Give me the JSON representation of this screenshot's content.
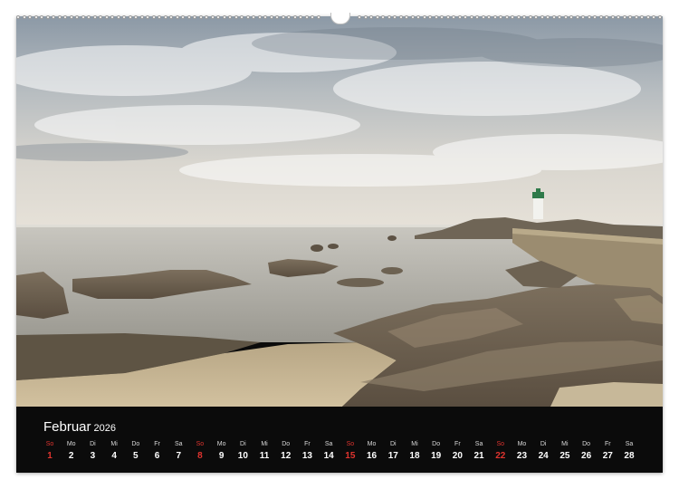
{
  "calendar": {
    "month": "Februar",
    "year": "2026",
    "sunday_color": "#e0342f",
    "days": [
      {
        "name": "So",
        "num": "1",
        "sunday": true
      },
      {
        "name": "Mo",
        "num": "2"
      },
      {
        "name": "Di",
        "num": "3"
      },
      {
        "name": "Mi",
        "num": "4"
      },
      {
        "name": "Do",
        "num": "5"
      },
      {
        "name": "Fr",
        "num": "6"
      },
      {
        "name": "Sa",
        "num": "7"
      },
      {
        "name": "So",
        "num": "8",
        "sunday": true
      },
      {
        "name": "Mo",
        "num": "9"
      },
      {
        "name": "Di",
        "num": "10"
      },
      {
        "name": "Mi",
        "num": "11"
      },
      {
        "name": "Do",
        "num": "12"
      },
      {
        "name": "Fr",
        "num": "13"
      },
      {
        "name": "Sa",
        "num": "14"
      },
      {
        "name": "So",
        "num": "15",
        "sunday": true
      },
      {
        "name": "Mo",
        "num": "16"
      },
      {
        "name": "Di",
        "num": "17"
      },
      {
        "name": "Mi",
        "num": "18"
      },
      {
        "name": "Do",
        "num": "19"
      },
      {
        "name": "Fr",
        "num": "20"
      },
      {
        "name": "Sa",
        "num": "21"
      },
      {
        "name": "So",
        "num": "22",
        "sunday": true
      },
      {
        "name": "Mo",
        "num": "23"
      },
      {
        "name": "Di",
        "num": "24"
      },
      {
        "name": "Mi",
        "num": "25"
      },
      {
        "name": "Do",
        "num": "26"
      },
      {
        "name": "Fr",
        "num": "27"
      },
      {
        "name": "Sa",
        "num": "28"
      }
    ]
  }
}
